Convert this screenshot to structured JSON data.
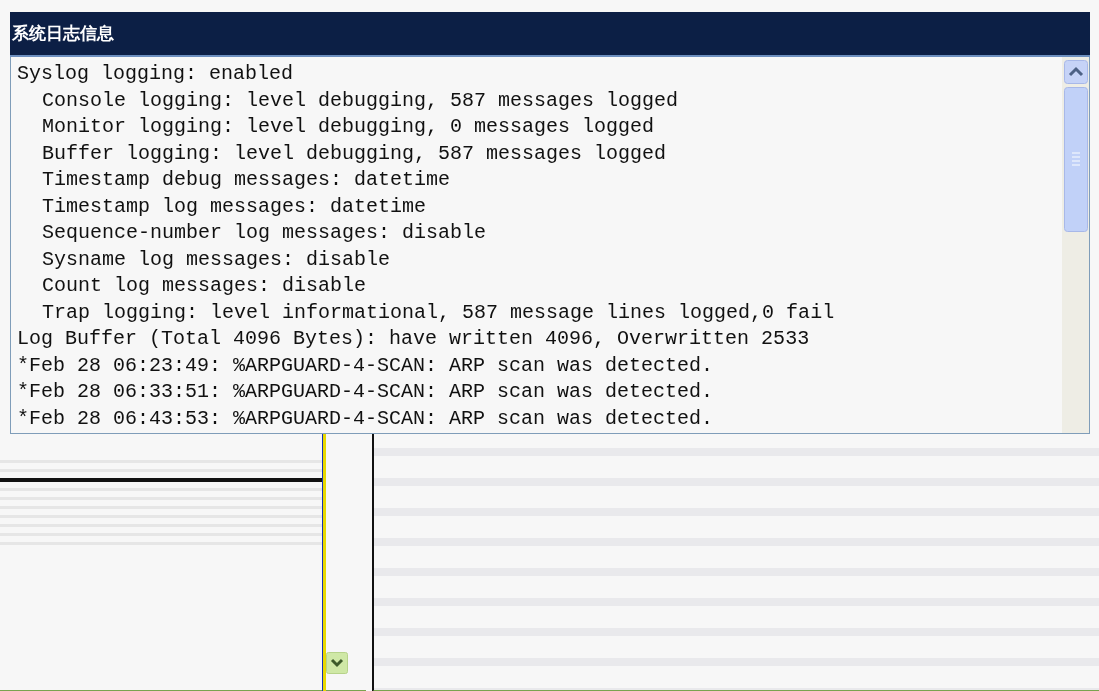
{
  "panel": {
    "title": "系统日志信息"
  },
  "log_lines": [
    {
      "text": "Syslog logging: enabled",
      "children": [
        {
          "text": "Console logging: level debugging, 587 messages logged"
        },
        {
          "text": "Monitor logging: level debugging, 0 messages logged"
        },
        {
          "text": "Buffer logging: level debugging, 587 messages logged"
        },
        {
          "text": "Timestamp debug messages: datetime"
        },
        {
          "text": "Timestamp log messages: datetime"
        },
        {
          "text": "Sequence-number log messages: disable"
        },
        {
          "text": "Sysname log messages: disable"
        },
        {
          "text": "Count log messages: disable"
        },
        {
          "text": "Trap logging: level informational, 587 message lines logged,0 fail"
        }
      ]
    },
    {
      "text": "Log Buffer (Total 4096 Bytes): have written 4096, Overwritten 2533"
    },
    {
      "text": "*Feb 28 06:23:49: %ARPGUARD-4-SCAN: ARP scan was detected."
    },
    {
      "text": "*Feb 28 06:33:51: %ARPGUARD-4-SCAN: ARP scan was detected."
    },
    {
      "text": "*Feb 28 06:43:53: %ARPGUARD-4-SCAN: ARP scan was detected."
    }
  ]
}
